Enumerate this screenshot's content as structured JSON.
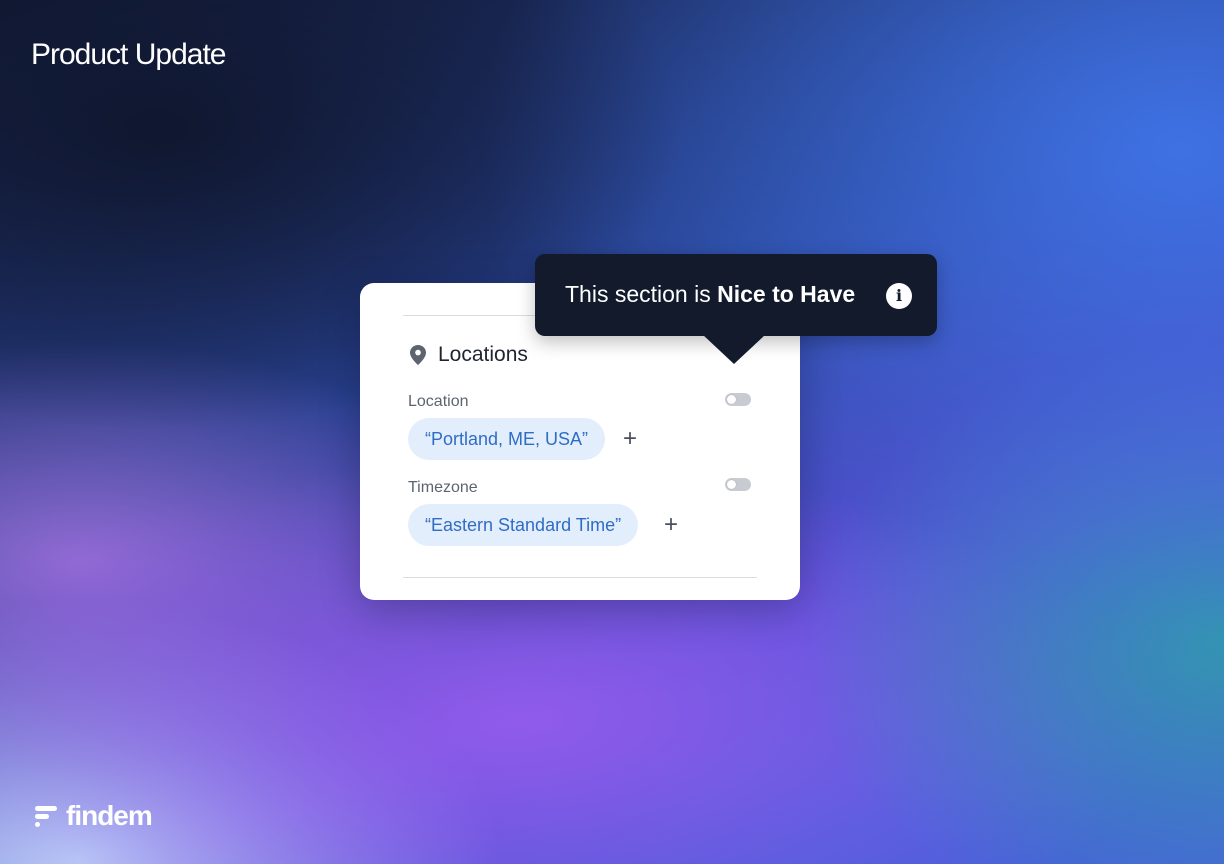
{
  "headline": "Product Update",
  "card": {
    "section_title": "Locations",
    "section_icon": "location-pin-icon",
    "fields": [
      {
        "label": "Location",
        "value": "“Portland, ME, USA”",
        "toggle_on": false,
        "add_icon": "plus-icon"
      },
      {
        "label": "Timezone",
        "value": "“Eastern Standard Time”",
        "toggle_on": false,
        "add_icon": "plus-icon"
      }
    ]
  },
  "tooltip": {
    "text_prefix": "This section is ",
    "text_emphasis": "Nice to Have",
    "icon": "info-icon"
  },
  "brand": {
    "name": "findem",
    "icon": "findem-logo-icon"
  },
  "colors": {
    "chip_background": "#e3eefc",
    "chip_text": "#2f6cc6",
    "tooltip_background": "#121a2c"
  }
}
